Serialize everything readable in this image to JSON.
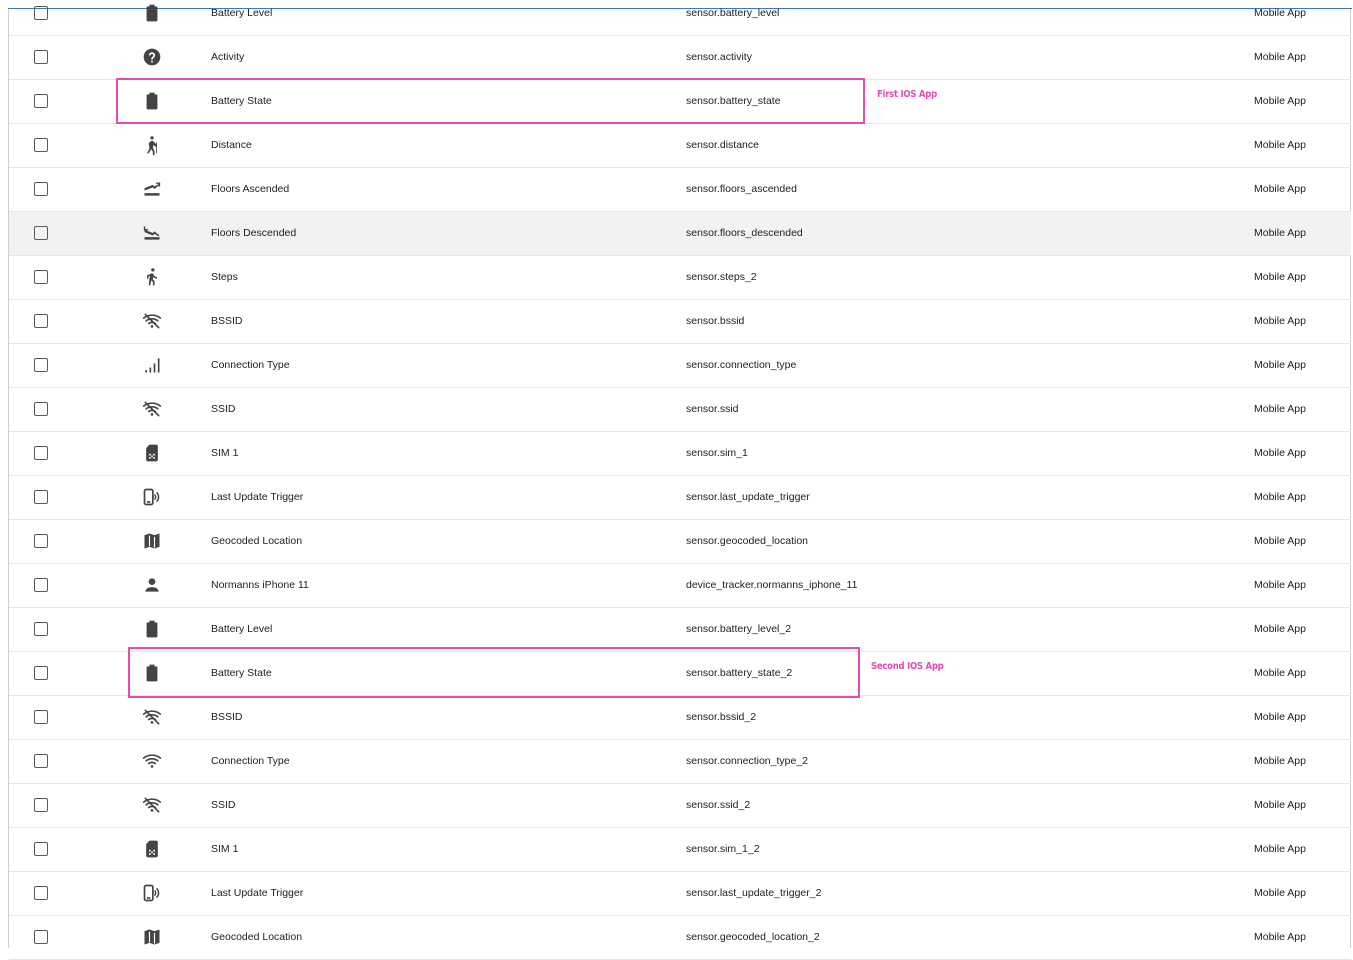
{
  "rows": [
    {
      "name": "Battery Level",
      "entity_id": "sensor.battery_level",
      "integration": "Mobile App",
      "icon": "battery-icon"
    },
    {
      "name": "Activity",
      "entity_id": "sensor.activity",
      "integration": "Mobile App",
      "icon": "help-circle-icon"
    },
    {
      "name": "Battery State",
      "entity_id": "sensor.battery_state",
      "integration": "Mobile App",
      "icon": "battery-icon"
    },
    {
      "name": "Distance",
      "entity_id": "sensor.distance",
      "integration": "Mobile App",
      "icon": "hiking-icon"
    },
    {
      "name": "Floors Ascended",
      "entity_id": "sensor.floors_ascended",
      "integration": "Mobile App",
      "icon": "stairs-up-icon"
    },
    {
      "name": "Floors Descended",
      "entity_id": "sensor.floors_descended",
      "integration": "Mobile App",
      "icon": "stairs-down-icon"
    },
    {
      "name": "Steps",
      "entity_id": "sensor.steps_2",
      "integration": "Mobile App",
      "icon": "walk-icon"
    },
    {
      "name": "BSSID",
      "entity_id": "sensor.bssid",
      "integration": "Mobile App",
      "icon": "wifi-off-icon"
    },
    {
      "name": "Connection Type",
      "entity_id": "sensor.connection_type",
      "integration": "Mobile App",
      "icon": "signal-bars-icon"
    },
    {
      "name": "SSID",
      "entity_id": "sensor.ssid",
      "integration": "Mobile App",
      "icon": "wifi-off-icon"
    },
    {
      "name": "SIM 1",
      "entity_id": "sensor.sim_1",
      "integration": "Mobile App",
      "icon": "sim-icon"
    },
    {
      "name": "Last Update Trigger",
      "entity_id": "sensor.last_update_trigger",
      "integration": "Mobile App",
      "icon": "cellphone-wireless-icon"
    },
    {
      "name": "Geocoded Location",
      "entity_id": "sensor.geocoded_location",
      "integration": "Mobile App",
      "icon": "map-icon"
    },
    {
      "name": "Normanns iPhone 11",
      "entity_id": "device_tracker.normanns_iphone_11",
      "integration": "Mobile App",
      "icon": "account-icon"
    },
    {
      "name": "Battery Level",
      "entity_id": "sensor.battery_level_2",
      "integration": "Mobile App",
      "icon": "battery-icon"
    },
    {
      "name": "Battery State",
      "entity_id": "sensor.battery_state_2",
      "integration": "Mobile App",
      "icon": "battery-icon"
    },
    {
      "name": "BSSID",
      "entity_id": "sensor.bssid_2",
      "integration": "Mobile App",
      "icon": "wifi-off-icon"
    },
    {
      "name": "Connection Type",
      "entity_id": "sensor.connection_type_2",
      "integration": "Mobile App",
      "icon": "wifi-icon"
    },
    {
      "name": "SSID",
      "entity_id": "sensor.ssid_2",
      "integration": "Mobile App",
      "icon": "wifi-off-icon"
    },
    {
      "name": "SIM 1",
      "entity_id": "sensor.sim_1_2",
      "integration": "Mobile App",
      "icon": "sim-icon"
    },
    {
      "name": "Last Update Trigger",
      "entity_id": "sensor.last_update_trigger_2",
      "integration": "Mobile App",
      "icon": "cellphone-wireless-icon"
    },
    {
      "name": "Geocoded Location",
      "entity_id": "sensor.geocoded_location_2",
      "integration": "Mobile App",
      "icon": "map-icon"
    }
  ],
  "annotations": {
    "first_label": "First IOS App",
    "second_label": "Second IOS App",
    "color": "#e64cb0"
  },
  "colors": {
    "icon": "#444444",
    "accent_line": "#3b78c4"
  }
}
